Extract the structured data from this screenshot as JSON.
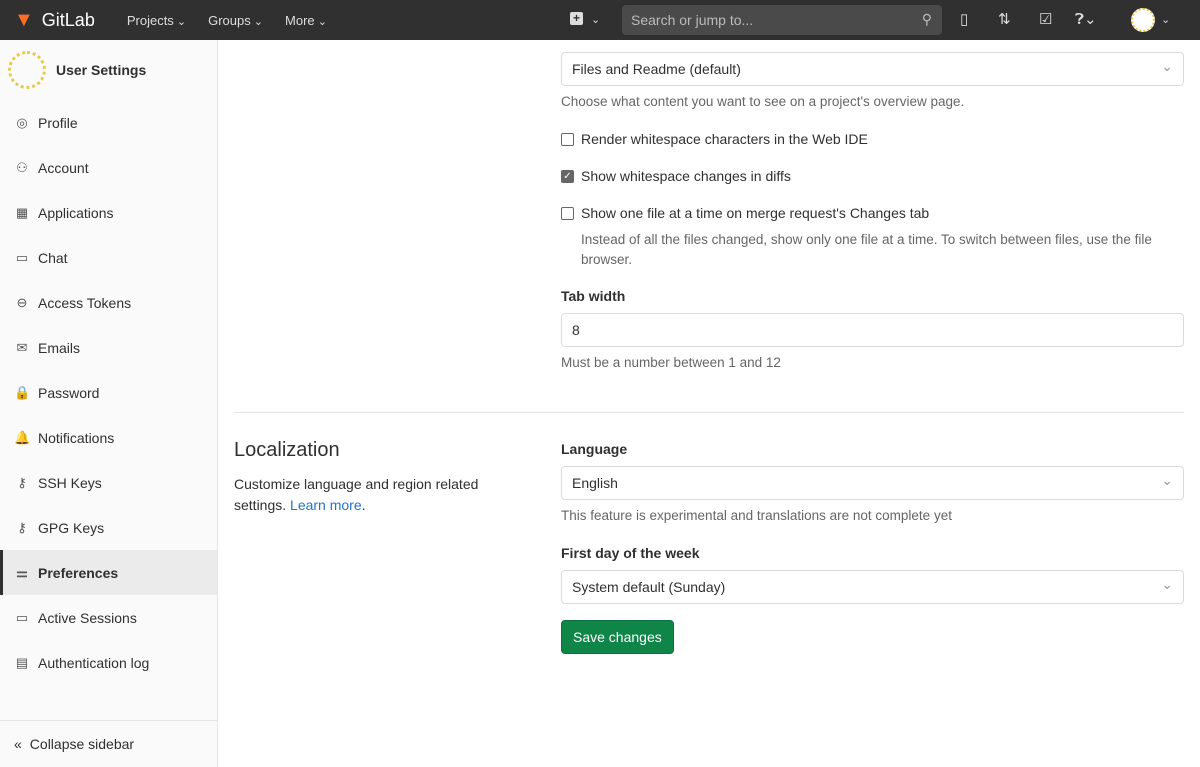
{
  "topbar": {
    "brand": "GitLab",
    "nav": [
      "Projects",
      "Groups",
      "More"
    ],
    "search_placeholder": "Search or jump to..."
  },
  "sidebar": {
    "title": "User Settings",
    "items": [
      {
        "label": "Profile",
        "icon": "profile-icon",
        "glyph": "◎"
      },
      {
        "label": "Account",
        "icon": "account-icon",
        "glyph": "⚇"
      },
      {
        "label": "Applications",
        "icon": "applications-icon",
        "glyph": "▦"
      },
      {
        "label": "Chat",
        "icon": "chat-icon",
        "glyph": "▭"
      },
      {
        "label": "Access Tokens",
        "icon": "token-icon",
        "glyph": "⊖"
      },
      {
        "label": "Emails",
        "icon": "mail-icon",
        "glyph": "✉"
      },
      {
        "label": "Password",
        "icon": "lock-icon",
        "glyph": "🔒"
      },
      {
        "label": "Notifications",
        "icon": "bell-icon",
        "glyph": "🔔"
      },
      {
        "label": "SSH Keys",
        "icon": "key-icon",
        "glyph": "⚷"
      },
      {
        "label": "GPG Keys",
        "icon": "key-icon",
        "glyph": "⚷"
      },
      {
        "label": "Preferences",
        "icon": "preferences-icon",
        "glyph": "⚌",
        "active": true
      },
      {
        "label": "Active Sessions",
        "icon": "monitor-icon",
        "glyph": "▭"
      },
      {
        "label": "Authentication log",
        "icon": "log-icon",
        "glyph": "▤"
      }
    ],
    "collapse": "Collapse sidebar"
  },
  "behavior": {
    "overview_value": "Files and Readme (default)",
    "overview_help": "Choose what content you want to see on a project's overview page.",
    "checkboxes": [
      {
        "label": "Render whitespace characters in the Web IDE",
        "checked": false
      },
      {
        "label": "Show whitespace changes in diffs",
        "checked": true
      },
      {
        "label": "Show one file at a time on merge request's Changes tab",
        "checked": false,
        "help": "Instead of all the files changed, show only one file at a time. To switch between files, use the file browser."
      }
    ],
    "tab_width_label": "Tab width",
    "tab_width_value": "8",
    "tab_width_help": "Must be a number between 1 and 12"
  },
  "localization": {
    "title": "Localization",
    "desc": "Customize language and region related settings.",
    "learn_more": "Learn more",
    "period": ".",
    "language_label": "Language",
    "language_value": "English",
    "language_help": "This feature is experimental and translations are not complete yet",
    "week_label": "First day of the week",
    "week_value": "System default (Sunday)"
  },
  "save": "Save changes",
  "colors": {
    "topbar": "#303030",
    "save": "#108548",
    "link": "#1f75cb"
  }
}
